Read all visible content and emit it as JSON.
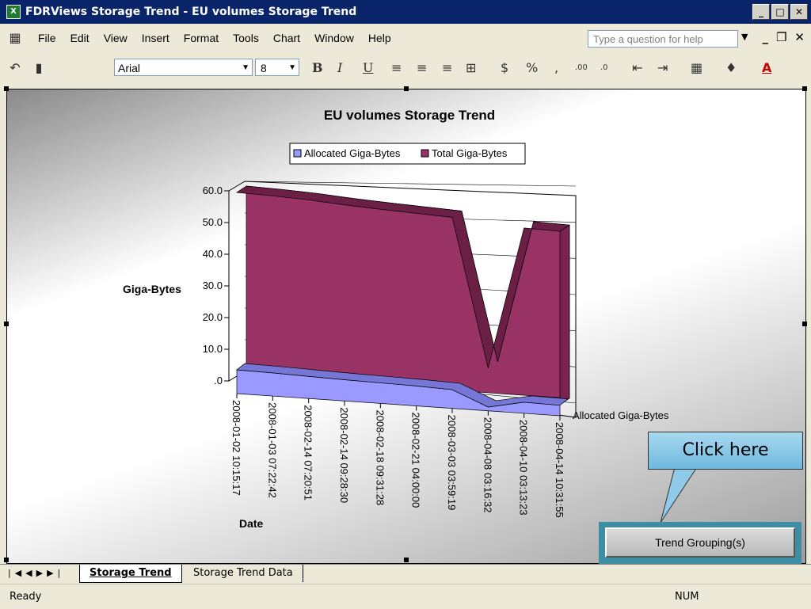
{
  "window": {
    "title": "FDRViews Storage Trend - EU volumes Storage Trend",
    "app_icon_glyph": "X"
  },
  "menu": [
    "File",
    "Edit",
    "View",
    "Insert",
    "Format",
    "Tools",
    "Chart",
    "Window",
    "Help"
  ],
  "help": {
    "placeholder": "Type a question for help"
  },
  "toolbar": {
    "font_name": "Arial",
    "font_size": "8",
    "bold": "B",
    "italic": "I",
    "underline": "U",
    "currency": "$",
    "percent": "%",
    "comma": ",",
    "inc_decimal": ".00",
    "dec_decimal": ".0",
    "font_color_label": "A"
  },
  "chart_data": {
    "type": "area",
    "title": "EU volumes Storage Trend",
    "xlabel": "Date",
    "ylabel": "Giga-Bytes",
    "ylim": [
      0,
      60
    ],
    "y_ticks": [
      "60.0",
      "50.0",
      "40.0",
      "30.0",
      "20.0",
      "10.0",
      ".0"
    ],
    "categories": [
      "2008-01-02 10:15:17",
      "2008-01-03 07:22:42",
      "2008-02-14 07:20:51",
      "2008-02-14 09:28:30",
      "2008-02-18 09:31:28",
      "2008-02-21 04:00:00",
      "2008-03-03 03:59:19",
      "2008-04-08 03:16:32",
      "2008-04-10 03:13:23",
      "2008-04-14 10:31:55"
    ],
    "series": [
      {
        "name": "Allocated Giga-Bytes",
        "color": "#9999ff",
        "values": [
          7.5,
          7.3,
          7.0,
          6.7,
          6.5,
          6.3,
          5.9,
          1.2,
          3.5,
          3.3
        ]
      },
      {
        "name": "Total Giga-Bytes",
        "color": "#993366",
        "values": [
          60.0,
          59.7,
          59.2,
          58.4,
          57.8,
          57.3,
          56.8,
          10.0,
          55.0,
          54.7
        ]
      }
    ],
    "legend": "top",
    "depth_axis_label": "Allocated Giga-Bytes"
  },
  "callout": {
    "text": "Click here"
  },
  "trend_button": {
    "label": "Trend Grouping(s)"
  },
  "sheets": [
    {
      "label": "Storage Trend",
      "active": true
    },
    {
      "label": "Storage Trend Data",
      "active": false
    }
  ],
  "status": {
    "text": "Ready",
    "num": "NUM"
  }
}
